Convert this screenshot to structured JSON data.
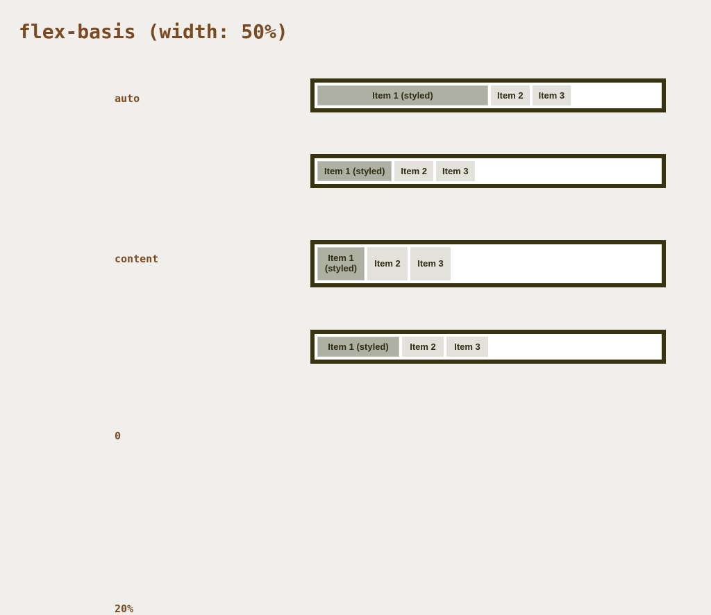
{
  "slide": {
    "title": "flex-basis (width: 50%)",
    "background_color": "#f1efeb",
    "accent_color": "#7a4a22",
    "border_color": "#37340f",
    "styled_item_color": "#adb0a2",
    "plain_item_color": "#e2e1dc",
    "item_text_color": "#2e2c12"
  },
  "rows": [
    {
      "label": "auto",
      "items": [
        {
          "text": "Item 1 (styled)",
          "styled": true
        },
        {
          "text": "Item 2",
          "styled": false
        },
        {
          "text": "Item 3",
          "styled": false
        }
      ]
    },
    {
      "label": "content",
      "items": [
        {
          "text": "Item 1 (styled)",
          "styled": true
        },
        {
          "text": "Item 2",
          "styled": false
        },
        {
          "text": "Item 3",
          "styled": false
        }
      ]
    },
    {
      "label": "0",
      "items": [
        {
          "text": "Item 1 (styled)",
          "styled": true
        },
        {
          "text": "Item 2",
          "styled": false
        },
        {
          "text": "Item 3",
          "styled": false
        }
      ]
    },
    {
      "label": "20%",
      "items": [
        {
          "text": "Item 1 (styled)",
          "styled": true
        },
        {
          "text": "Item 2",
          "styled": false
        },
        {
          "text": "Item 3",
          "styled": false
        }
      ]
    }
  ]
}
